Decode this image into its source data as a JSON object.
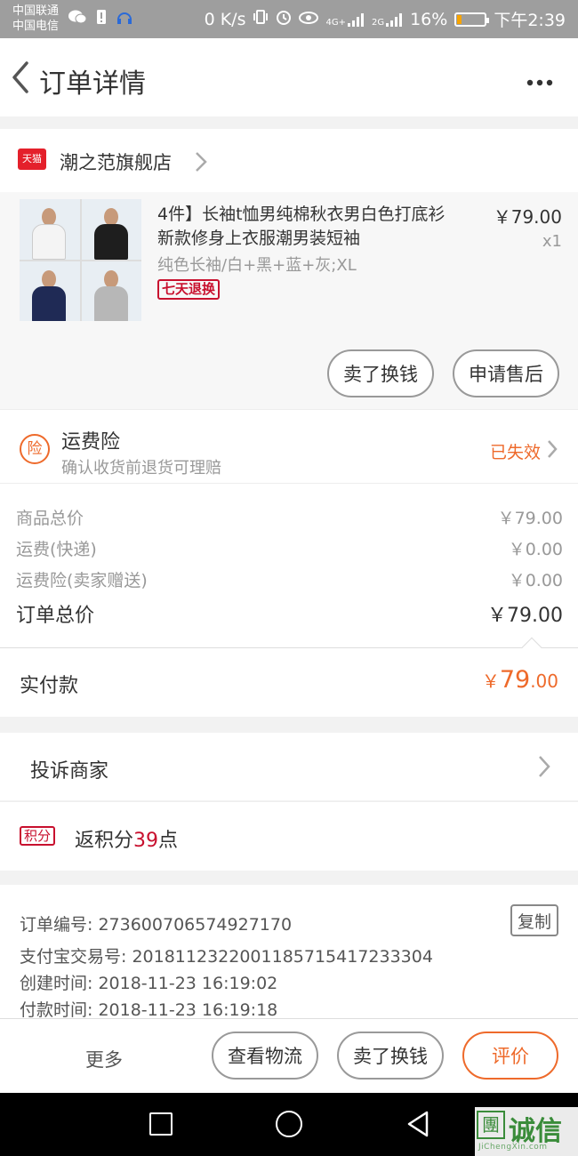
{
  "status_bar": {
    "carrier1": "中国联通",
    "carrier2": "中国电信",
    "speed": "0 K/s",
    "signal1": "4G+",
    "signal2": "2G",
    "battery": "16%",
    "battery_level": 0.16,
    "time": "下午2:39"
  },
  "header": {
    "title": "订单详情"
  },
  "shop": {
    "logo_text": "天猫",
    "name": "潮之范旗舰店"
  },
  "product": {
    "title": "4件】长袖t恤男纯棉秋衣男白色打底衫新款修身上衣服潮男装短袖",
    "sku": "纯色长袖/白+黑+蓝+灰;XL",
    "tag": "七天退换",
    "price": "￥79.00",
    "quantity": "x1",
    "shirt_colors": [
      "#f4f4f4",
      "#1e1e1e",
      "#1f2a55",
      "#b7b7b7"
    ],
    "sell_button": "卖了换钱",
    "aftersale_button": "申请售后"
  },
  "insurance": {
    "icon_text": "险",
    "title": "运费险",
    "subtitle": "确认收货前退货可理赔",
    "status": "已失效"
  },
  "prices": {
    "rows": [
      {
        "label": "商品总价",
        "value": "￥79.00"
      },
      {
        "label": "运费(快递)",
        "value": "￥0.00"
      },
      {
        "label": "运费险(卖家赠送)",
        "value": "￥0.00"
      }
    ],
    "total_label": "订单总价",
    "total_value": "￥79.00"
  },
  "paid": {
    "label": "实付款",
    "currency": "￥",
    "integer": "79",
    "decimal": ".00"
  },
  "complain": {
    "label": "投诉商家"
  },
  "points": {
    "badge": "积分",
    "prefix": "返积分",
    "number": "39",
    "suffix": "点"
  },
  "order_info": {
    "order_no_label": "订单编号:",
    "order_no": "273600706574927170",
    "copy_button": "复制",
    "alipay_label": "支付宝交易号:",
    "alipay_no": "2018112322001185715417233304",
    "created_label": "创建时间:",
    "created": "2018-11-23 16:19:02",
    "paid_label": "付款时间:",
    "paid_time": "2018-11-23 16:19:18"
  },
  "bottom_bar": {
    "more": "更多",
    "logistics": "查看物流",
    "sell": "卖了换钱",
    "review": "评价"
  },
  "watermark": {
    "logo": "團",
    "text": "诚信",
    "url": "JiChengXin.com"
  },
  "colors": {
    "accent_orange": "#ee6a2b",
    "tmall_red": "#e4202b",
    "points_red": "#c8102e"
  }
}
